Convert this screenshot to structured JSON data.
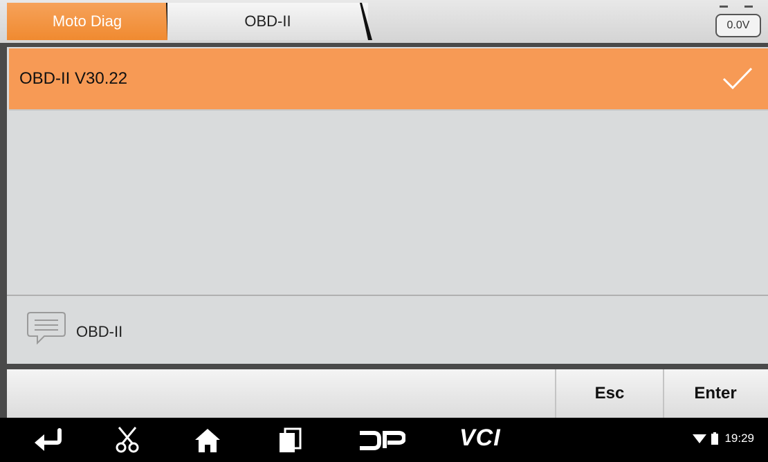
{
  "header": {
    "tabs": [
      {
        "label": "Moto Diag",
        "active": true
      },
      {
        "label": "OBD-II",
        "active": false
      }
    ],
    "voltage": "0.0V"
  },
  "list": {
    "items": [
      {
        "label": "OBD-II  V30.22",
        "selected": true
      }
    ]
  },
  "info": {
    "text": "OBD-II",
    "icon": "message-icon"
  },
  "buttons": {
    "esc": "Esc",
    "enter": "Enter"
  },
  "navbar": {
    "icons": [
      "back-icon",
      "scissors-icon",
      "home-icon",
      "recent-apps-icon",
      "dp-icon",
      "vci-icon"
    ],
    "vci_label": "VCI",
    "time": "19:29"
  },
  "colors": {
    "accent": "#f08a30",
    "selected_row": "#f79a55",
    "panel": "#d9dbdc"
  }
}
